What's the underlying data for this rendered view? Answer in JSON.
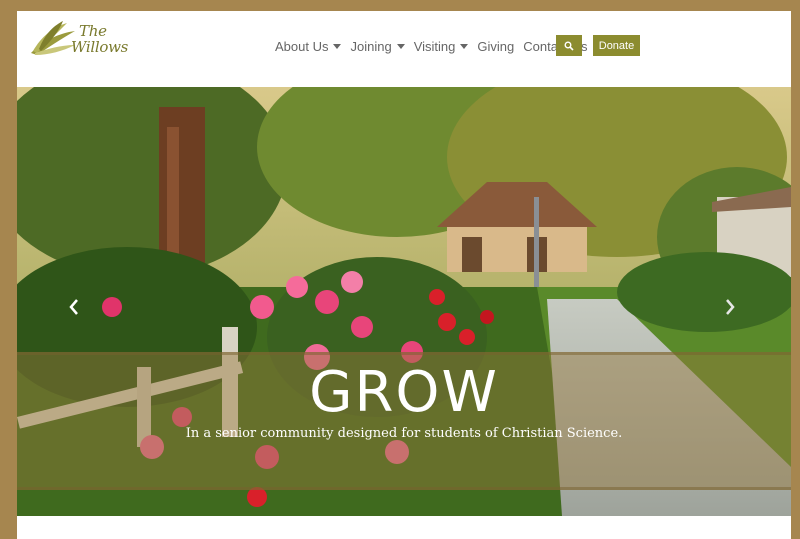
{
  "brand": {
    "logo_line1": "The",
    "logo_line2": "Willows",
    "accent": "#8c8c2f",
    "frame": "#a6864f"
  },
  "nav": {
    "about": "About Us",
    "joining": "Joining",
    "visiting": "Visiting",
    "giving": "Giving",
    "contact": "Contact Us",
    "search_icon": "search-icon",
    "donate": "Donate"
  },
  "hero": {
    "title": "GROW",
    "subtitle": "In a senior community designed for students of Christian Science.",
    "prev_icon": "chevron-left-icon",
    "next_icon": "chevron-right-icon"
  }
}
